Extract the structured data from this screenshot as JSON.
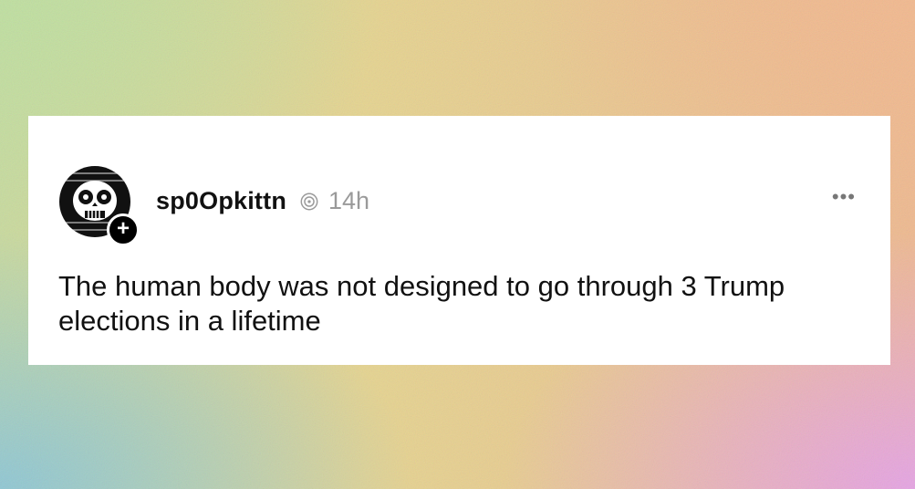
{
  "post": {
    "username": "sp0Opkittn",
    "time": "14h",
    "text": "The human body was not designed to go through 3 Trump elections in a lifetime",
    "more_label": "•••",
    "follow_label": "+"
  },
  "icons": {
    "avatar": "skull-avatar-icon",
    "threads": "threads-icon",
    "more": "more-options-icon",
    "follow": "follow-plus-icon"
  },
  "colors": {
    "card": "#ffffff",
    "text": "#111111",
    "meta": "#9a9a9a"
  }
}
